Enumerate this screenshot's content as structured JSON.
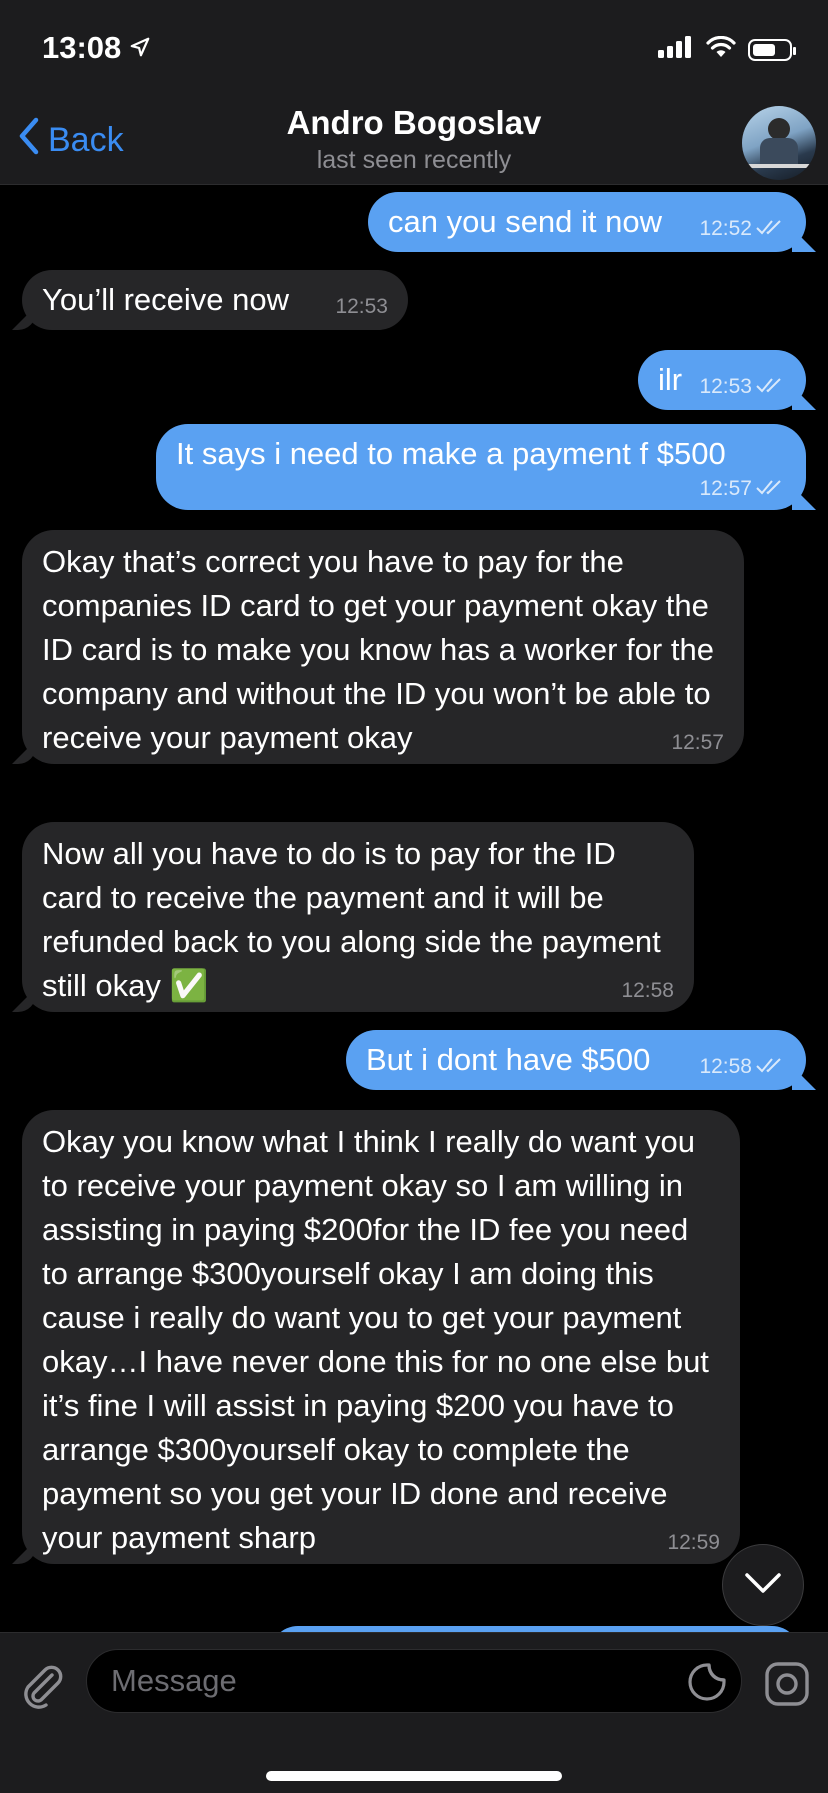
{
  "status_bar": {
    "time": "13:08"
  },
  "header": {
    "back_label": "Back",
    "contact_name": "Andro Bogoslav",
    "contact_status": "last seen recently"
  },
  "messages": [
    {
      "dir": "out",
      "text": "can you send it now",
      "time": "12:52",
      "read": true
    },
    {
      "dir": "in",
      "text": "You’ll receive now",
      "time": "12:53"
    },
    {
      "dir": "out",
      "text": "ilr",
      "time": "12:53",
      "read": true
    },
    {
      "dir": "out",
      "text": "It says i need to make a payment f $500",
      "time": "12:57",
      "read": true
    },
    {
      "dir": "in",
      "text": "Okay that’s correct you have to pay for the companies ID card to get your payment okay the ID card is to make you know has a worker for the company and without the ID you won’t be able to receive your payment okay",
      "time": "12:57"
    },
    {
      "dir": "in",
      "text": "Now all you have to do is to pay for the ID card to receive the payment and it will be refunded back to you along side the payment still okay ✅",
      "time": "12:58"
    },
    {
      "dir": "out",
      "text": "But i dont have $500",
      "time": "12:58",
      "read": true
    },
    {
      "dir": "in",
      "text": "Okay you know what I think I really do want you to receive your payment okay so I am willing in assisting in paying $200for the ID fee you need to arrange $300yourself okay I am doing this cause i really do want you to get your payment okay…I have never done this for no one else but it’s fine I will assist in paying $200 you have to arrange $300yourself okay to complete the payment so you get your ID done and receive your payment sharp",
      "time": "12:59"
    }
  ],
  "input": {
    "placeholder": "Message"
  },
  "colors": {
    "accent": "#3a8cf2",
    "outgoing_bubble": "#5aa1f2",
    "incoming_bubble": "#262628",
    "bar": "#1c1c1e"
  }
}
